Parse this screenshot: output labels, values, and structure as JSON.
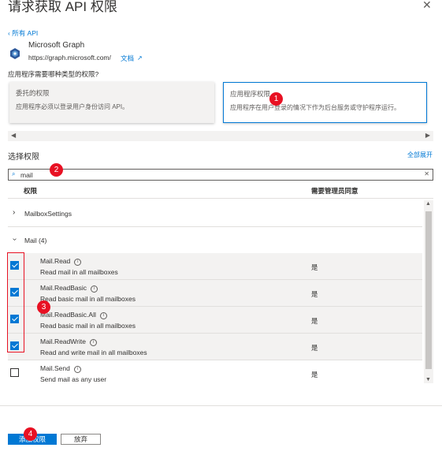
{
  "header": {
    "title": "请求获取 API 权限",
    "close_icon": "close-icon"
  },
  "api": {
    "back_label": "‹ 所有 API",
    "name": "Microsoft Graph",
    "url": "https://graph.microsoft.com/",
    "docs_label": "文档",
    "logo_icon": "microsoft-graph-logo"
  },
  "question": "应用程序需要哪种类型的权限?",
  "permission_types": [
    {
      "title": "委托的权限",
      "description": "应用程序必须以登录用户身份访问 API。",
      "selected": false
    },
    {
      "title": "应用程序权限",
      "description": "应用程序在用户登录的情况下作为后台服务或守护程序运行。",
      "selected": true
    }
  ],
  "select_permissions": {
    "title": "选择权限",
    "expand_all_label": "全部展开"
  },
  "search": {
    "value": "mail",
    "icon": "search-icon"
  },
  "table": {
    "headers": {
      "permission": "权限",
      "admin_consent": "需要管理员同意"
    },
    "groups": [
      {
        "label": "MailboxSettings",
        "expanded": false
      },
      {
        "label": "Mail (4)",
        "expanded": true
      }
    ],
    "rows": [
      {
        "name": "Mail.Read",
        "description": "Read mail in all mailboxes",
        "admin_consent": "是",
        "checked": true
      },
      {
        "name": "Mail.ReadBasic",
        "description": "Read basic mail in all mailboxes",
        "admin_consent": "是",
        "checked": true
      },
      {
        "name": "Mail.ReadBasic.All",
        "description": "Read basic mail in all mailboxes",
        "admin_consent": "是",
        "checked": true
      },
      {
        "name": "Mail.ReadWrite",
        "description": "Read and write mail in all mailboxes",
        "admin_consent": "是",
        "checked": true
      },
      {
        "name": "Mail.Send",
        "description": "Send mail as any user",
        "admin_consent": "是",
        "checked": false
      }
    ]
  },
  "annotations": {
    "badge1": "1",
    "badge2": "2",
    "badge3": "3",
    "badge4": "4",
    "color": "#e81123"
  },
  "footer": {
    "add_button": "添加权限",
    "discard_button": "放弃"
  },
  "colors": {
    "accent": "#0078d4",
    "selected_row": "#f3f2f1"
  }
}
